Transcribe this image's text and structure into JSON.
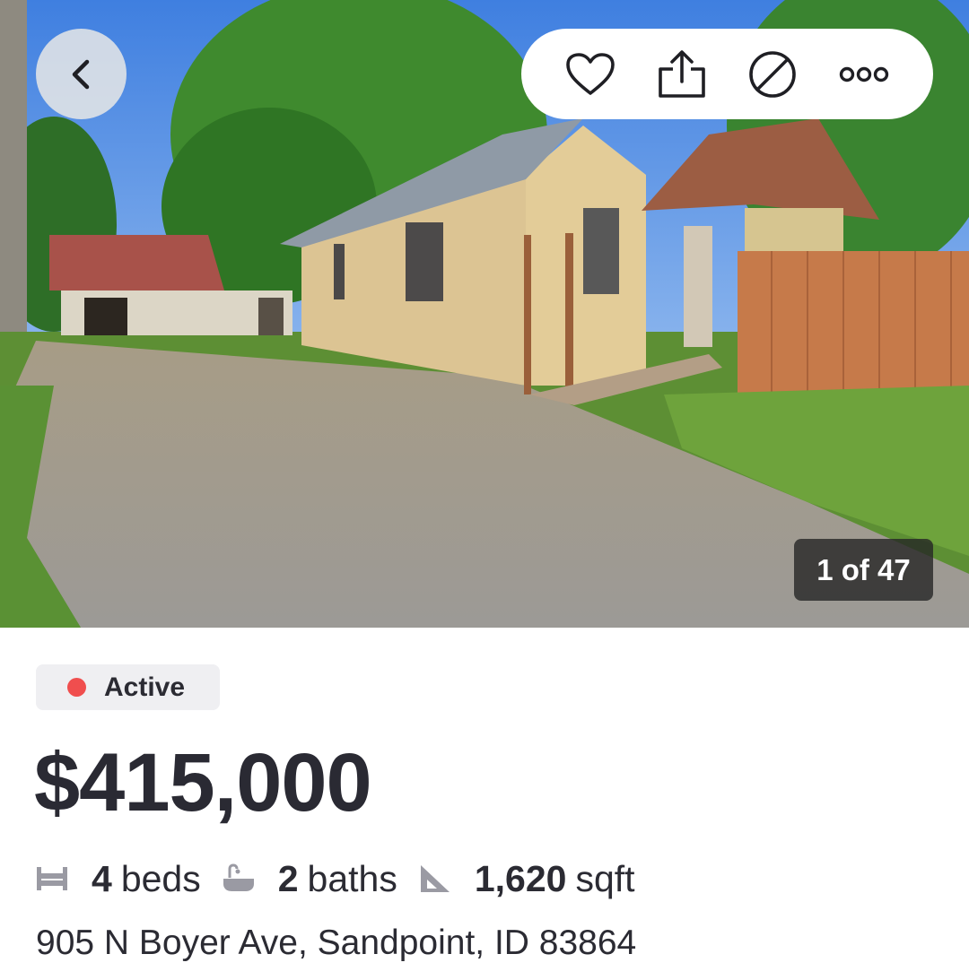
{
  "gallery": {
    "counter": "1 of 47"
  },
  "actions": {
    "back_icon": "chevron-left-icon",
    "favorite_icon": "heart-icon",
    "share_icon": "share-icon",
    "hide_icon": "block-icon",
    "more_icon": "more-icon"
  },
  "listing": {
    "status": "Active",
    "status_color": "#f04e4e",
    "price": "$415,000",
    "beds_value": "4",
    "beds_label": "beds",
    "baths_value": "2",
    "baths_label": "baths",
    "sqft_value": "1,620",
    "sqft_label": "sqft",
    "address": "905 N Boyer Ave, Sandpoint, ID 83864"
  }
}
